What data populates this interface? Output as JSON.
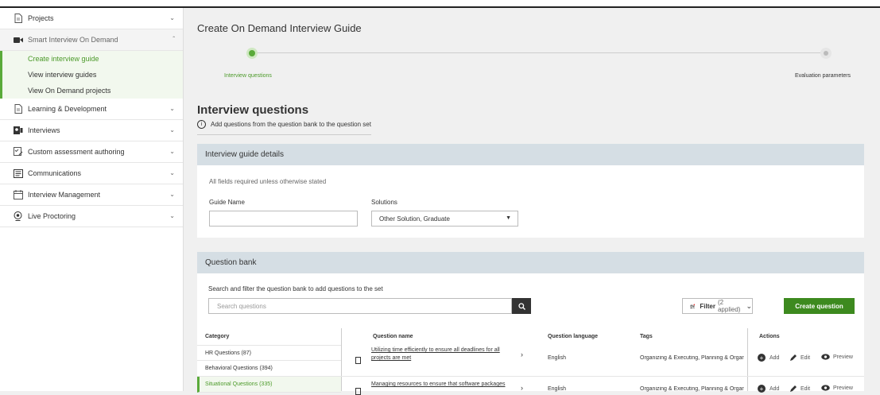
{
  "sidebar": {
    "items": [
      {
        "label": "Projects",
        "icon": "document-icon"
      },
      {
        "label": "Smart Interview On Demand",
        "icon": "video-camera-icon",
        "open": true
      },
      {
        "label": "Learning & Development",
        "icon": "document-icon"
      },
      {
        "label": "Interviews",
        "icon": "interview-person-icon"
      },
      {
        "label": "Custom assessment authoring",
        "icon": "edit-checklist-icon"
      },
      {
        "label": "Communications",
        "icon": "message-icon"
      },
      {
        "label": "Interview Management",
        "icon": "calendar-icon"
      },
      {
        "label": "Live Proctoring",
        "icon": "webcam-icon"
      }
    ],
    "subitems": [
      "Create interview guide",
      "View interview guides",
      "View On Demand projects"
    ]
  },
  "main": {
    "title": "Create On Demand Interview Guide",
    "steps": [
      "Interview questions",
      "Evaluation parameters"
    ],
    "section_title": "Interview questions",
    "info_text": "Add questions from the question bank to the question set"
  },
  "guide_details": {
    "header": "Interview guide details",
    "note": "All fields required unless otherwise stated",
    "guide_name_label": "Guide Name",
    "guide_name_value": "",
    "solutions_label": "Solutions",
    "solutions_value": "Other Solution, Graduate"
  },
  "question_bank": {
    "header": "Question bank",
    "note": "Search and filter the question bank to add questions to the set",
    "search_placeholder": "Search questions",
    "filter_label": "Filter",
    "filter_count": "(2 applied)",
    "create_label": "Create question",
    "columns": {
      "category": "Category",
      "name": "Question name",
      "language": "Question language",
      "tags": "Tags",
      "actions": "Actions"
    },
    "categories": [
      "HR Questions (87)",
      "Behavioral Questions (394)",
      "Situational Questions (335)"
    ],
    "rows": [
      {
        "name_line1": "Utilizing time efficiently to ensure all deadlines for all",
        "name_line2": "projects are met",
        "language": "English",
        "tags": "Organizing & Executing, Planning & Orgar"
      },
      {
        "name_line1": "Managing resources to ensure that software packages",
        "name_line2": "",
        "language": "English",
        "tags": "Organizing & Executing, Planning & Orgar"
      }
    ],
    "actions": {
      "add": "Add",
      "edit": "Edit",
      "preview": "Preview"
    }
  },
  "colors": {
    "accent": "#5aaa3a",
    "primary_button": "#3d8a1f",
    "panel_header": "#d5dee4",
    "filter_dot": "#e53935"
  }
}
